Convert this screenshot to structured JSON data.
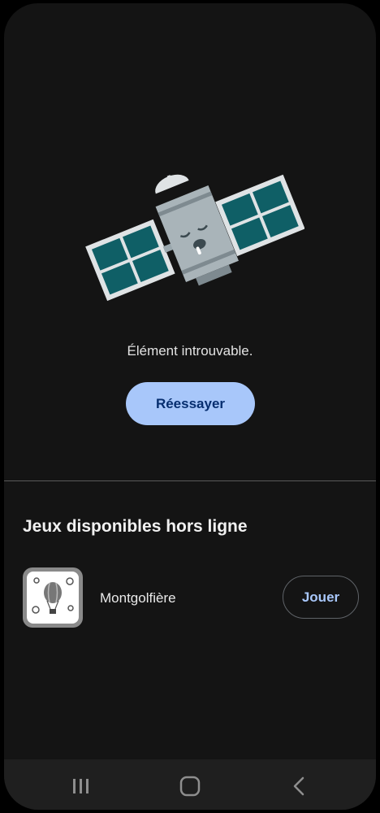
{
  "error": {
    "message": "Élément introuvable.",
    "retry_label": "Réessayer"
  },
  "offline_games": {
    "title": "Jeux disponibles hors ligne",
    "games": [
      {
        "name": "Montgolfière",
        "play_label": "Jouer",
        "icon": "hot-air-balloon-icon"
      }
    ]
  },
  "nav": {
    "items": [
      "recent-apps-icon",
      "home-icon",
      "back-icon"
    ]
  },
  "colors": {
    "background": "#141414",
    "accent": "#a8c7fa",
    "accent_text": "#062e6f",
    "satellite_panel": "#0f5f66",
    "satellite_body": "#9aa7ad"
  }
}
